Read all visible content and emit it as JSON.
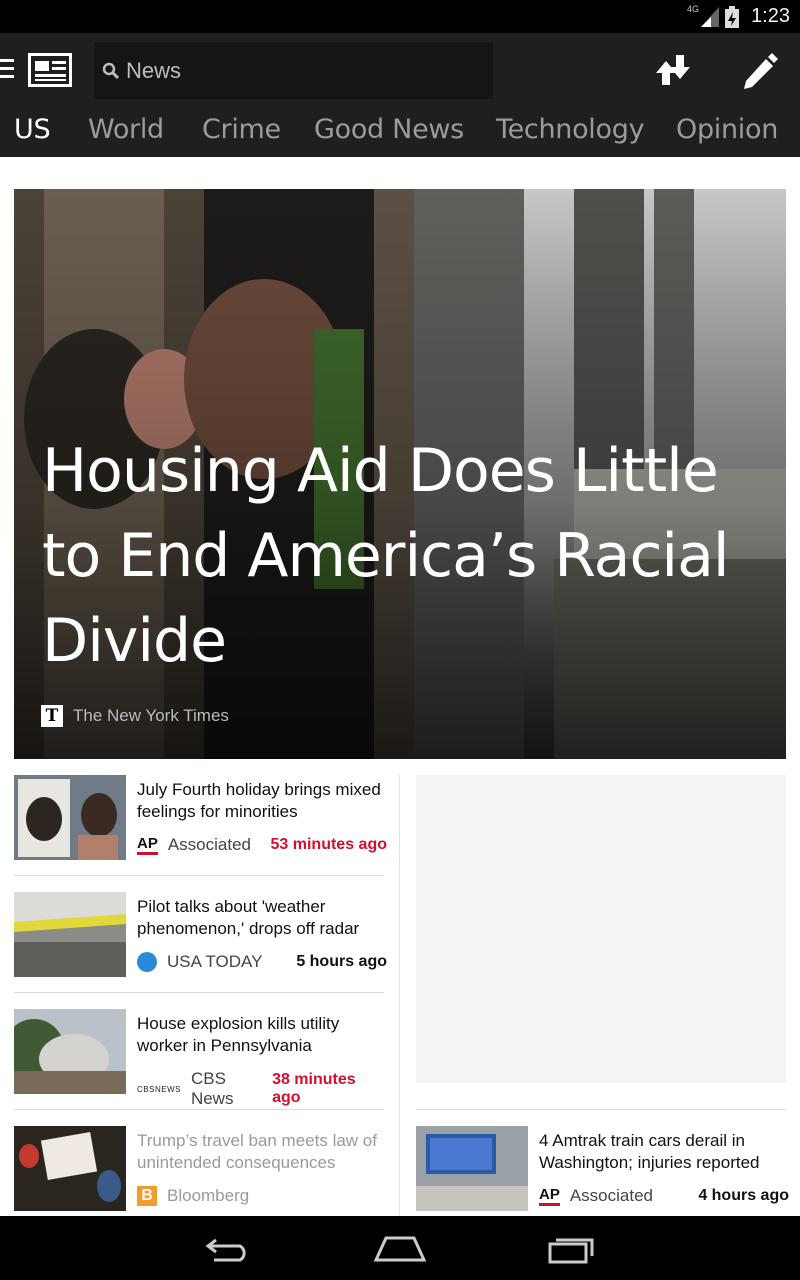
{
  "status_bar": {
    "network": "4G",
    "time": "1:23"
  },
  "app_bar": {
    "search_placeholder": "News",
    "icons": [
      "menu-icon",
      "news-app-logo-icon",
      "search-icon",
      "download-icon",
      "edit-icon"
    ]
  },
  "tabs": [
    {
      "label": "US",
      "active": true
    },
    {
      "label": "World",
      "active": false
    },
    {
      "label": "Crime",
      "active": false
    },
    {
      "label": "Good News",
      "active": false
    },
    {
      "label": "Technology",
      "active": false
    },
    {
      "label": "Opinion",
      "active": false
    }
  ],
  "hero": {
    "title": "Housing Aid Does Little to End America’s Racial Divide",
    "source": "The New York Times"
  },
  "stories": [
    {
      "title": "July Fourth holiday brings mixed feelings for minorities",
      "source": "Associated",
      "time": "53 minutes ago",
      "logo": "ap-logo-icon"
    },
    {
      "title": "Pilot talks about 'weather phenomenon,' drops off radar",
      "source": "USA TODAY",
      "time": "5 hours ago",
      "logo": "usa-today-logo-icon"
    },
    {
      "title": "House explosion kills utility worker in Pennsylvania",
      "source": "CBS News",
      "time": "38 minutes ago",
      "logo": "cbs-logo-icon"
    },
    {
      "title": "Trump’s travel ban meets law of unintended consequences",
      "source": "Bloomberg",
      "logo": "bloomberg-logo-icon"
    },
    {
      "title": "4 Amtrak train cars derail in Washington; injuries reported",
      "source": "Associated",
      "time": "4 hours ago",
      "logo": "ap-logo-icon"
    }
  ],
  "logos": {
    "ap": "AP",
    "bloomberg": "B",
    "nyt": "T",
    "cbs": "CBSNEWS"
  },
  "nav_bar": {
    "icons": [
      "back-icon",
      "home-icon",
      "recent-apps-icon"
    ]
  },
  "colors": {
    "accent_red": "#d0102e",
    "app_bar": "#1d201e",
    "ap_red": "#d0102e",
    "bloomberg_orange": "#f39c2a"
  }
}
